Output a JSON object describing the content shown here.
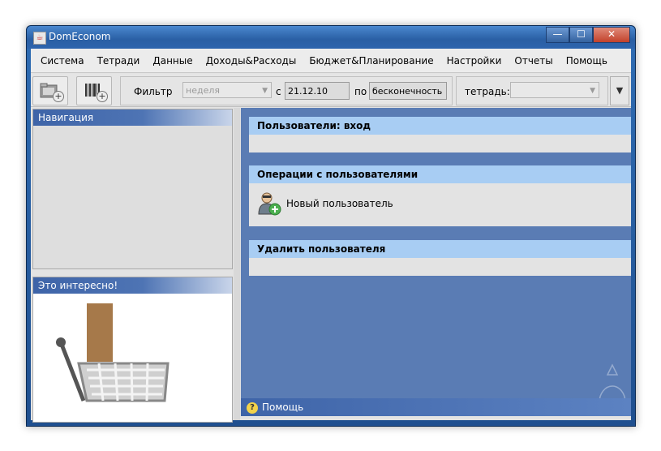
{
  "window": {
    "title": "DomEconom",
    "controls": {
      "minimize": "—",
      "maximize": "☐",
      "close": "✕"
    }
  },
  "menu": [
    "Система",
    "Тетради",
    "Данные",
    "Доходы&Расходы",
    "Бюджет&Планирование",
    "Настройки",
    "Отчеты",
    "Помощь"
  ],
  "toolbar": {
    "filter_label": "Фильтр",
    "period_value": "неделя",
    "from_label": "с",
    "from_value": "21.12.10",
    "to_label": "по",
    "to_value": "бесконечность",
    "notebook_label": "тетрадь:",
    "notebook_value": ""
  },
  "left": {
    "navigation_title": "Навигация",
    "interesting_title": "Это интересно!"
  },
  "right": {
    "login_title": "Пользователи: вход",
    "operations_title": "Операции с пользователями",
    "new_user_label": "Новый пользователь",
    "delete_title": "Удалить пользователя",
    "help_title": "Помощь"
  },
  "colors": {
    "section_header": "#a8cdf3",
    "pane_bg": "#5a7cb4",
    "panel_title": "#3e64a8"
  }
}
